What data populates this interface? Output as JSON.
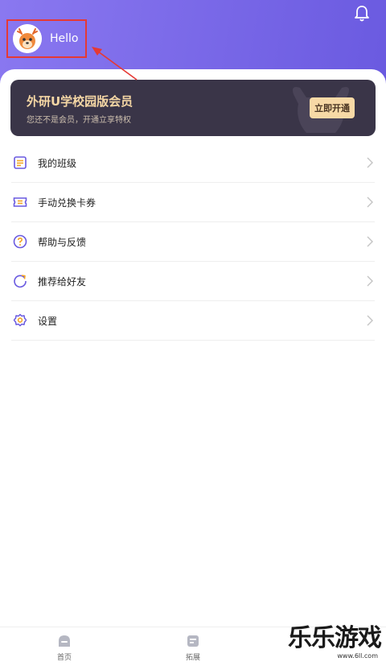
{
  "header": {
    "greeting": "Hello"
  },
  "vip_card": {
    "title": "外研U学校园版会员",
    "subtitle": "您还不是会员，开通立享特权",
    "button_label": "立即开通"
  },
  "menu": {
    "items": [
      {
        "label": "我的班级",
        "icon": "class-list-icon"
      },
      {
        "label": "手动兑换卡券",
        "icon": "ticket-icon"
      },
      {
        "label": "帮助与反馈",
        "icon": "help-icon"
      },
      {
        "label": "推荐给好友",
        "icon": "share-refresh-icon"
      },
      {
        "label": "设置",
        "icon": "settings-gear-icon"
      }
    ]
  },
  "tabbar": {
    "tabs": [
      {
        "label": "首页",
        "icon": "home-icon"
      },
      {
        "label": "拓展",
        "icon": "extension-icon"
      }
    ]
  },
  "watermark": {
    "main": "乐乐游戏",
    "sub": "www.6ll.com"
  },
  "colors": {
    "header_gradient_start": "#8a78f0",
    "header_gradient_end": "#6a5ae0",
    "accent_purple": "#6a5ae0",
    "vip_card_bg": "#3a3548",
    "vip_gold": "#f4d6a4",
    "highlight_red": "#e53935"
  }
}
